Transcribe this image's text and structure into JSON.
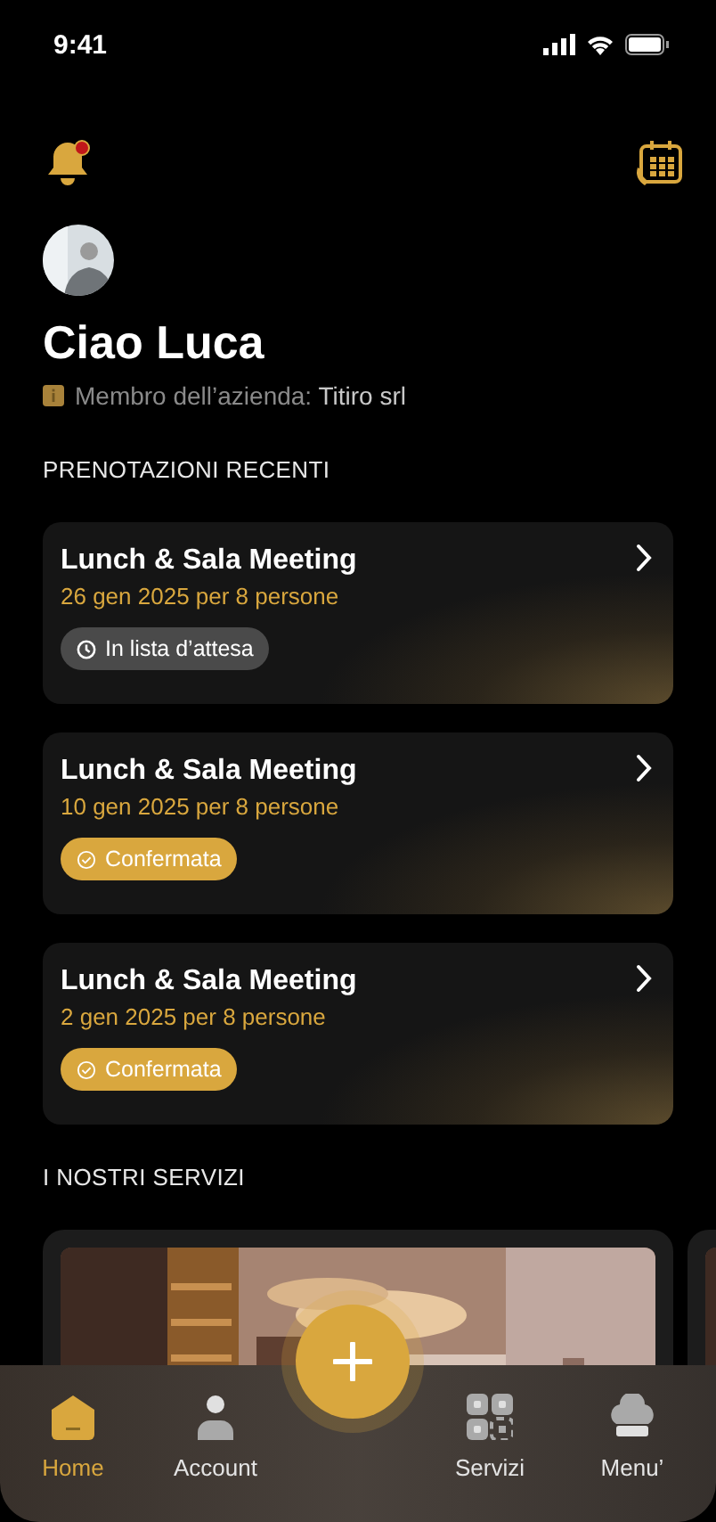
{
  "status_bar": {
    "time": "9:41"
  },
  "header": {
    "has_notification": true
  },
  "greeting": "Ciao Luca",
  "membership": {
    "label": "Membro dell’azienda:",
    "company": "Titiro srl"
  },
  "recent_heading": "PRENOTAZIONI RECENTI",
  "bookings": [
    {
      "title": "Lunch & Sala Meeting",
      "detail": "26 gen 2025 per 8 persone",
      "status": {
        "kind": "waiting",
        "label": "In lista d’attesa"
      }
    },
    {
      "title": "Lunch & Sala Meeting",
      "detail": "10 gen 2025 per 8 persone",
      "status": {
        "kind": "confirmed",
        "label": "Confermata"
      }
    },
    {
      "title": "Lunch & Sala Meeting",
      "detail": "2 gen 2025 per 8 persone",
      "status": {
        "kind": "confirmed",
        "label": "Confermata"
      }
    }
  ],
  "services_heading": "I NOSTRI SERVIZI",
  "nav": [
    {
      "kind": "home",
      "label": "Home",
      "selected": true
    },
    {
      "kind": "account",
      "label": "Account",
      "selected": false
    },
    {
      "kind": "add"
    },
    {
      "kind": "services",
      "label": "Servizi",
      "selected": false
    },
    {
      "kind": "menu",
      "label": "Menu’",
      "selected": false
    }
  ]
}
